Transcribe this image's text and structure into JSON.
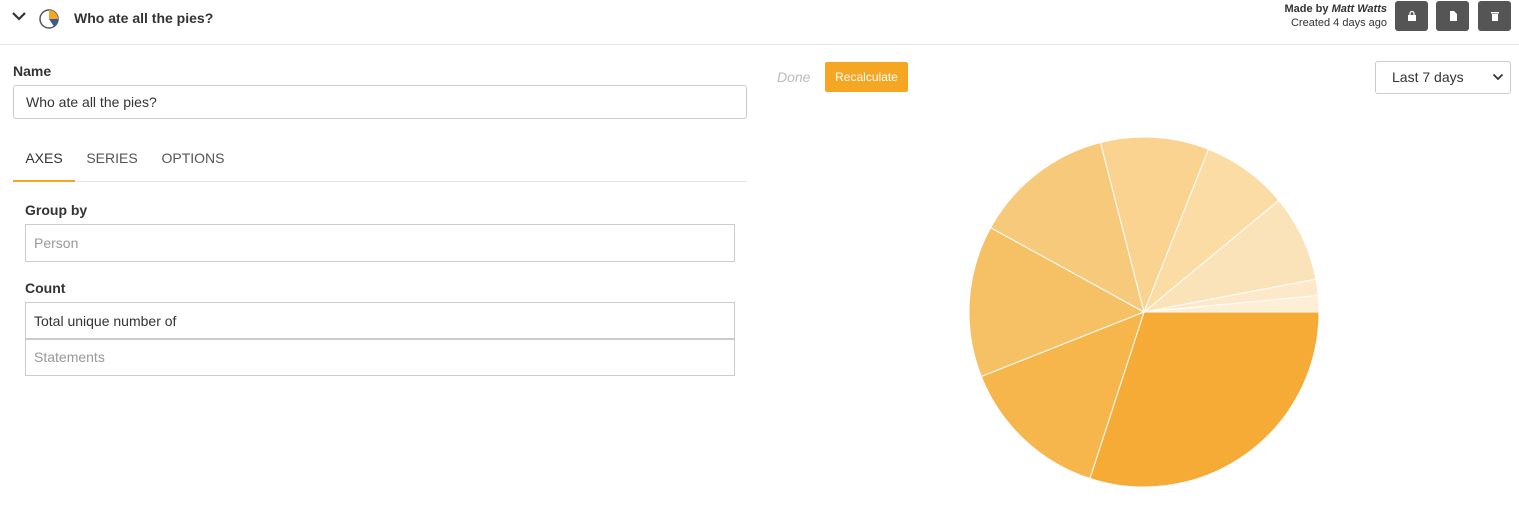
{
  "header": {
    "title": "Who ate all the pies?",
    "made_by_prefix": "Made by ",
    "author": "Matt Watts",
    "created": "Created 4 days ago"
  },
  "form": {
    "name_label": "Name",
    "name_value": "Who ate all the pies?",
    "tabs": [
      {
        "label": "AXES",
        "active": true
      },
      {
        "label": "SERIES",
        "active": false
      },
      {
        "label": "OPTIONS",
        "active": false
      }
    ],
    "group_by_label": "Group by",
    "group_by_placeholder": "Person",
    "count_label": "Count",
    "count_value": "Total unique number of",
    "count_placeholder": "Statements"
  },
  "toolbar": {
    "status": "Done",
    "recalculate_label": "Recalculate",
    "time_range": "Last 7 days"
  },
  "colors": {
    "accent": "#f5a623",
    "button_dark": "#555555"
  },
  "chart_data": {
    "type": "pie",
    "values": [
      30,
      14,
      14,
      13,
      10,
      8,
      8,
      1.5,
      1.5
    ],
    "colors": [
      "#f5ab35",
      "#f6b64b",
      "#f6c064",
      "#f7c97a",
      "#f9d38f",
      "#fadca4",
      "#fbe3b9",
      "#fde8c9",
      "#fdeed6"
    ]
  }
}
